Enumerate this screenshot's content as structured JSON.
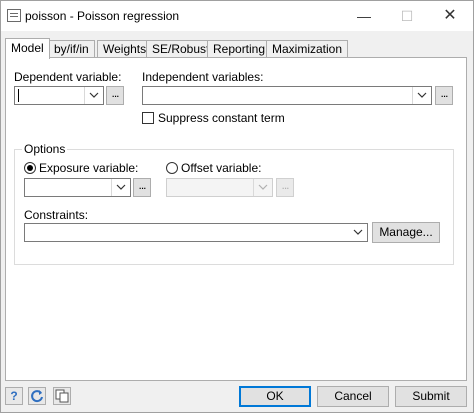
{
  "window": {
    "title": "poisson - Poisson regression",
    "min_glyph": "—",
    "max_glyph": "☐",
    "close_glyph": "✕"
  },
  "tabs": [
    {
      "label": "Model",
      "active": true
    },
    {
      "label": "by/if/in"
    },
    {
      "label": "Weights"
    },
    {
      "label": "SE/Robust"
    },
    {
      "label": "Reporting"
    },
    {
      "label": "Maximization"
    }
  ],
  "model": {
    "dependent_label": "Dependent variable:",
    "dependent_value": "",
    "independent_label": "Independent variables:",
    "independent_value": "",
    "suppress_constant_label": "Suppress constant term",
    "suppress_constant_checked": false,
    "browse_label": "...",
    "options": {
      "legend": "Options",
      "exposure_label": "Exposure variable:",
      "exposure_selected": true,
      "offset_label": "Offset variable:",
      "offset_selected": false,
      "constraints_label": "Constraints:",
      "constraints_value": "",
      "manage_label": "Manage..."
    }
  },
  "footer": {
    "help_glyph": "?",
    "ok_label": "OK",
    "cancel_label": "Cancel",
    "submit_label": "Submit"
  },
  "colors": {
    "accent": "#0078d7",
    "help_icon": "#2f6fc0"
  }
}
